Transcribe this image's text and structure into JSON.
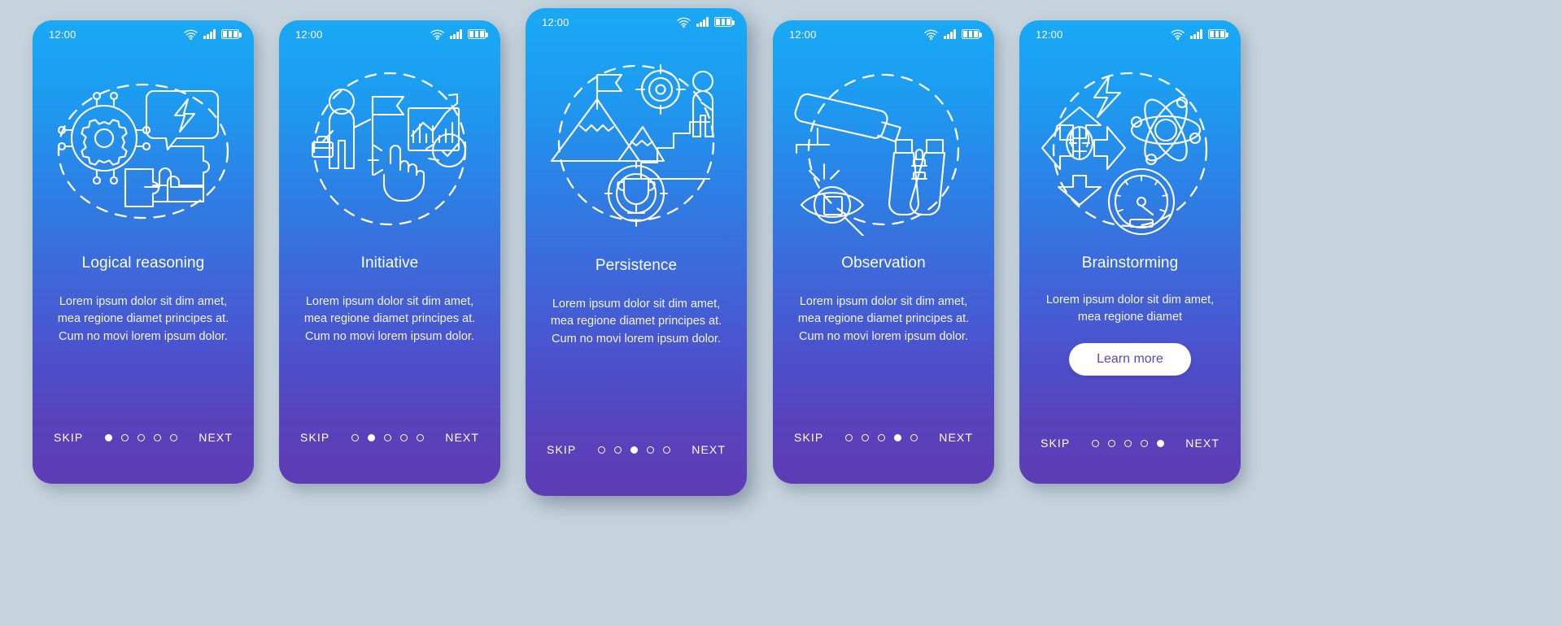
{
  "background_color": "#c6d4dd",
  "gradient": {
    "top": "#19a9f5",
    "bottom": "#5d3cb4"
  },
  "accent_button": {
    "bg": "#ffffff",
    "text_color": "#5b46b5"
  },
  "statusbar": {
    "time": "12:00",
    "icons": [
      "wifi-icon",
      "cellular-signal-icon",
      "battery-icon"
    ]
  },
  "nav": {
    "skip_label": "SKIP",
    "next_label": "NEXT",
    "total_dots": 5
  },
  "screens": [
    {
      "id": "logical-reasoning",
      "title": "Logical reasoning",
      "body": "Lorem ipsum dolor sit dim amet, mea regione diamet principes at. Cum no movi lorem ipsum dolor.",
      "active_dot": 1,
      "illustration": "gear-network-lightning-puzzle-icon",
      "has_learn_more": false
    },
    {
      "id": "initiative",
      "title": "Initiative",
      "body": "Lorem ipsum dolor sit dim amet, mea regione diamet principes at. Cum no movi lorem ipsum dolor.",
      "active_dot": 2,
      "illustration": "person-flag-chart-hand-icon",
      "has_learn_more": false
    },
    {
      "id": "persistence",
      "title": "Persistence",
      "body": "Lorem ipsum dolor sit dim amet, mea regione diamet principes at. Cum no movi lorem ipsum dolor.",
      "active_dot": 3,
      "illustration": "mountain-target-stairs-trophy-icon",
      "has_learn_more": false
    },
    {
      "id": "observation",
      "title": "Observation",
      "body": "Lorem ipsum dolor sit dim amet, mea regione diamet principes at. Cum no movi lorem ipsum dolor.",
      "active_dot": 4,
      "illustration": "cctv-binoculars-eye-magnifier-icon",
      "has_learn_more": false
    },
    {
      "id": "brainstorming",
      "title": "Brainstorming",
      "body": "Lorem ipsum dolor sit dim amet, mea regione diamet",
      "active_dot": 5,
      "illustration": "brain-arrows-atom-gauge-lightning-icon",
      "has_learn_more": true,
      "learn_more_label": "Learn more"
    }
  ]
}
